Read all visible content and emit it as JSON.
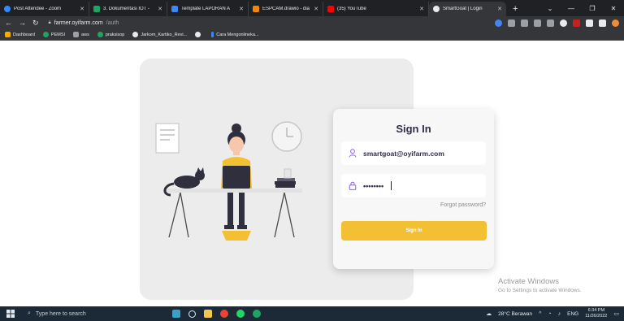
{
  "browser": {
    "tabs": [
      {
        "title": "Post Attendee - Zoom",
        "favicon_color": "#2d8cff"
      },
      {
        "title": "3. Dokumentasi IOT -",
        "favicon_color": "#1fa463"
      },
      {
        "title": "Template LAPORAN A",
        "favicon_color": "#4285f4"
      },
      {
        "title": "ESPCAM.drawio - dia",
        "favicon_color": "#f08705"
      },
      {
        "title": "(35) YouTube",
        "favicon_color": "#ff0000"
      },
      {
        "title": "SmartGoat | Login",
        "favicon_color": "#e8eaed",
        "active": true
      }
    ],
    "new_tab": "+",
    "url_host": "farmer.oyifarm.com",
    "url_path": "/auth",
    "bookmarks": [
      {
        "label": "Dashboard",
        "color": "#f9ab00"
      },
      {
        "label": "PEMSI",
        "color": "#1fa463"
      },
      {
        "label": "aws",
        "color": "#9aa0a6"
      },
      {
        "label": "praksisop",
        "color": "#1fa463"
      },
      {
        "label": "Jarkom_Kartiko_Revi...",
        "color": "#e8eaed"
      },
      {
        "label": "",
        "color": "#e8eaed"
      },
      {
        "label": "Cara Mengonlineka...",
        "color": "#4285f4"
      }
    ]
  },
  "login": {
    "title": "Sign In",
    "email_value": "smartgoat@oyifarm.com",
    "password_value": "••••••••",
    "forgot_label": "Forgot password?",
    "signin_label": "Sign In"
  },
  "watermark": {
    "line1": "Activate Windows",
    "line2": "Go to Settings to activate Windows."
  },
  "taskbar": {
    "search_placeholder": "Type here to search",
    "weather": "28°C Berawan",
    "lang": "ENG",
    "time": "6:34 PM",
    "date": "11/26/2022"
  },
  "colors": {
    "accent": "#f3bf33",
    "icon_purple": "#8b5cf6",
    "title_dark": "#2e2e45"
  }
}
